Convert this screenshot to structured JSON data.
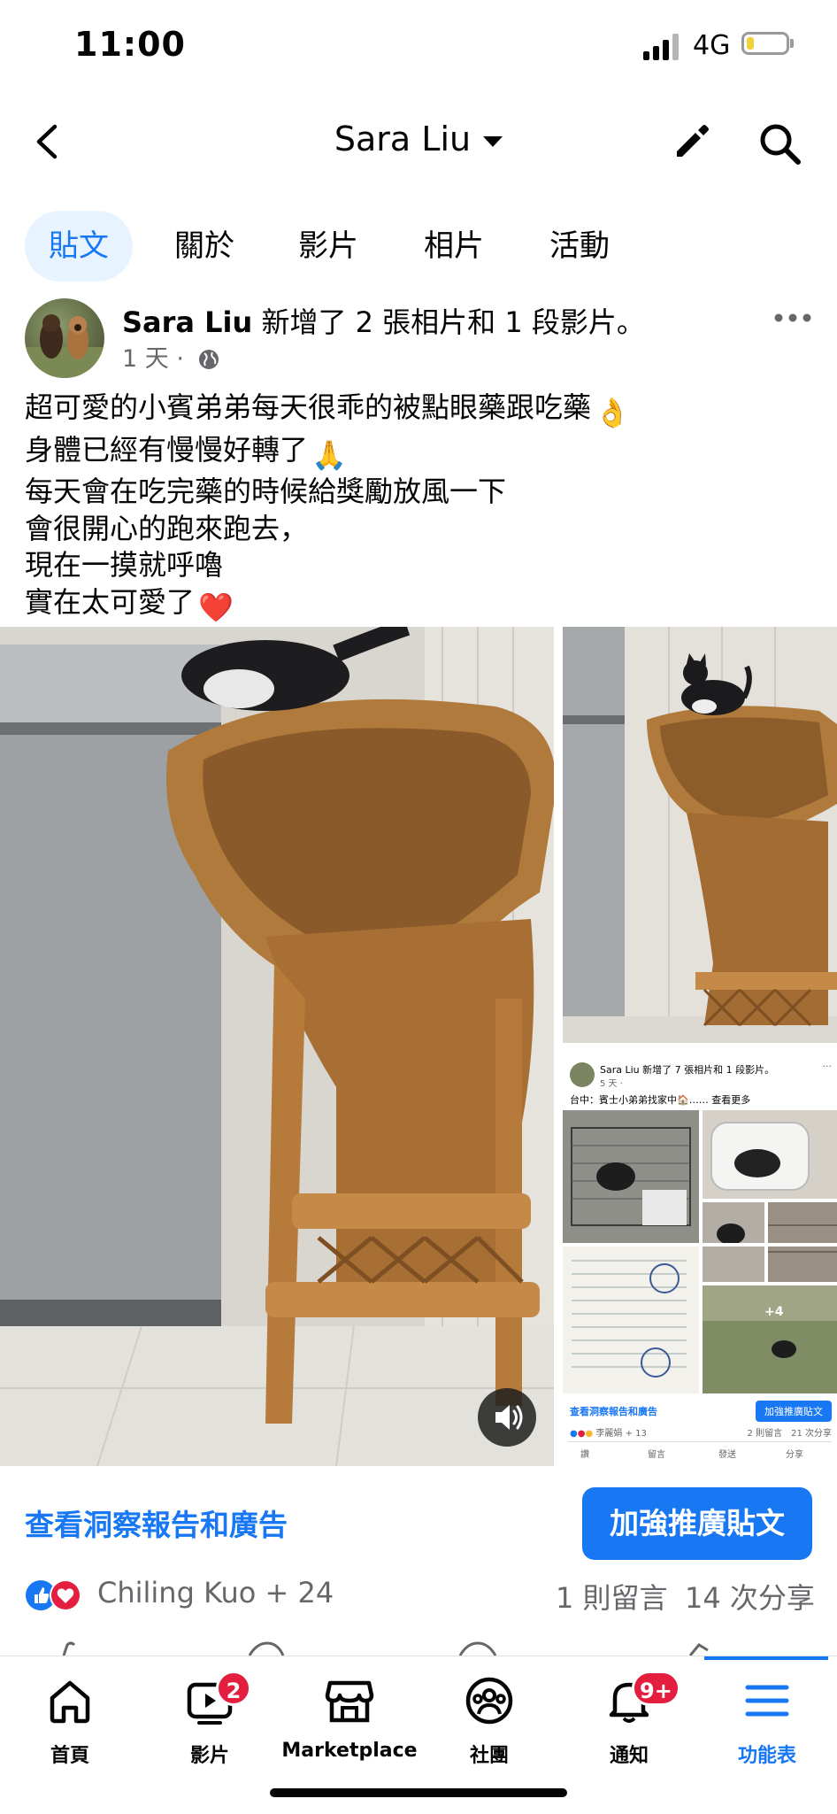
{
  "status_bar": {
    "time": "11:00",
    "network": "4G"
  },
  "header": {
    "title": "Sara Liu"
  },
  "tabs": [
    {
      "label": "貼文",
      "active": true
    },
    {
      "label": "關於",
      "active": false
    },
    {
      "label": "影片",
      "active": false
    },
    {
      "label": "相片",
      "active": false
    },
    {
      "label": "活動",
      "active": false
    }
  ],
  "post": {
    "author": "Sara Liu",
    "action_text": " 新增了 2 張相片和 1 段影片。",
    "time": "1 天 ·",
    "lines": [
      {
        "text": "超可愛的小賓弟弟每天很乖的被點眼藥跟吃藥",
        "emoji": "👌"
      },
      {
        "text": "身體已經有慢慢好轉了",
        "emoji": "🙏"
      },
      {
        "text": "每天會在吃完藥的時候給獎勵放風一下",
        "emoji": ""
      },
      {
        "text": "會很開心的跑來跑去，",
        "emoji": ""
      },
      {
        "text": "現在一摸就呼嚕",
        "emoji": ""
      },
      {
        "text": "實在太可愛了",
        "emoji": "❤️"
      }
    ]
  },
  "embedded_screenshot": {
    "author_line": "Sara Liu 新增了 7 張相片和 1 段影片。",
    "time": "5 天 ·",
    "caption": "台中：賓士小弟弟找家中🏠…… 查看更多",
    "more_count": "+4",
    "insights": "查看洞察報告和廣告",
    "boost": "加強推廣貼文",
    "reactors": "李麗娟 + 13",
    "stats": "2 則留言　21 次分享",
    "actions": [
      "讚",
      "留言",
      "發送",
      "分享"
    ]
  },
  "insights_link": "查看洞察報告和廣告",
  "boost_button": "加強推廣貼文",
  "reactions": {
    "names": "Chiling Kuo + 24",
    "comments": "1 則留言",
    "shares": "14 次分享"
  },
  "bottom_nav": [
    {
      "label": "首頁",
      "icon": "home-icon",
      "badge": ""
    },
    {
      "label": "影片",
      "icon": "video-icon",
      "badge": "2"
    },
    {
      "label": "Marketplace",
      "icon": "marketplace-icon",
      "badge": ""
    },
    {
      "label": "社團",
      "icon": "groups-icon",
      "badge": ""
    },
    {
      "label": "通知",
      "icon": "bell-icon",
      "badge": "9+"
    },
    {
      "label": "功能表",
      "icon": "menu-icon",
      "badge": ""
    }
  ],
  "colors": {
    "accent": "#1877f2",
    "badge": "#e41e3f",
    "text_secondary": "#65676b"
  }
}
